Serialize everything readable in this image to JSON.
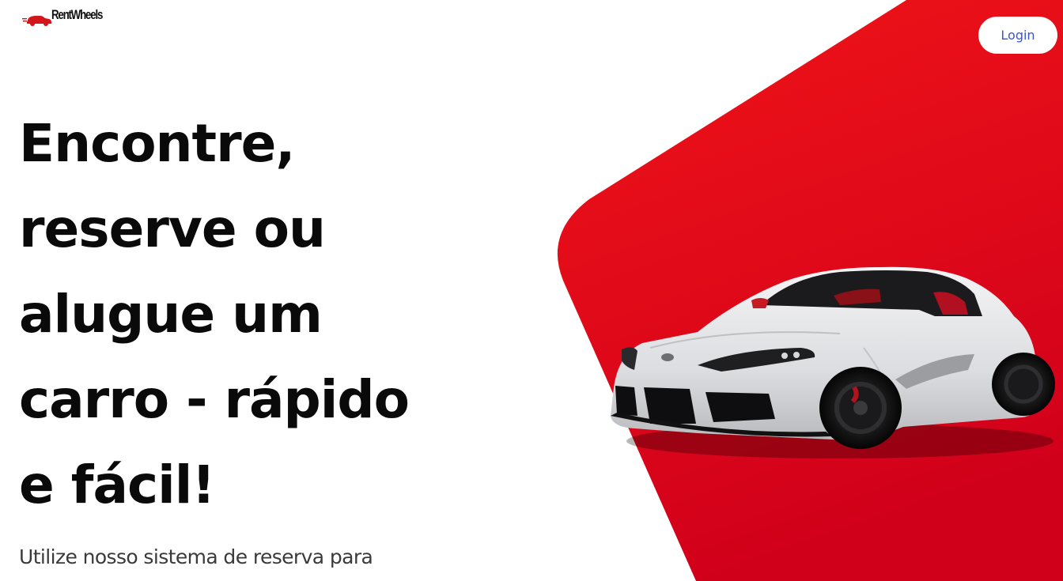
{
  "brand": {
    "name": "RentWheels",
    "logo_icon": "red-car-icon"
  },
  "header": {
    "login_label": "Login"
  },
  "hero": {
    "headline_lines": [
      "Encontre,",
      "reserve ou",
      "alugue um",
      "carro - rápido",
      "e fácil!"
    ],
    "subtext": "Utilize nosso sistema de reserva para",
    "image": "white-sports-car"
  },
  "colors": {
    "accent": "#e30613",
    "accent_dark": "#d1001a",
    "login_text": "#3b55c9",
    "headline": "#0a0a0a"
  }
}
